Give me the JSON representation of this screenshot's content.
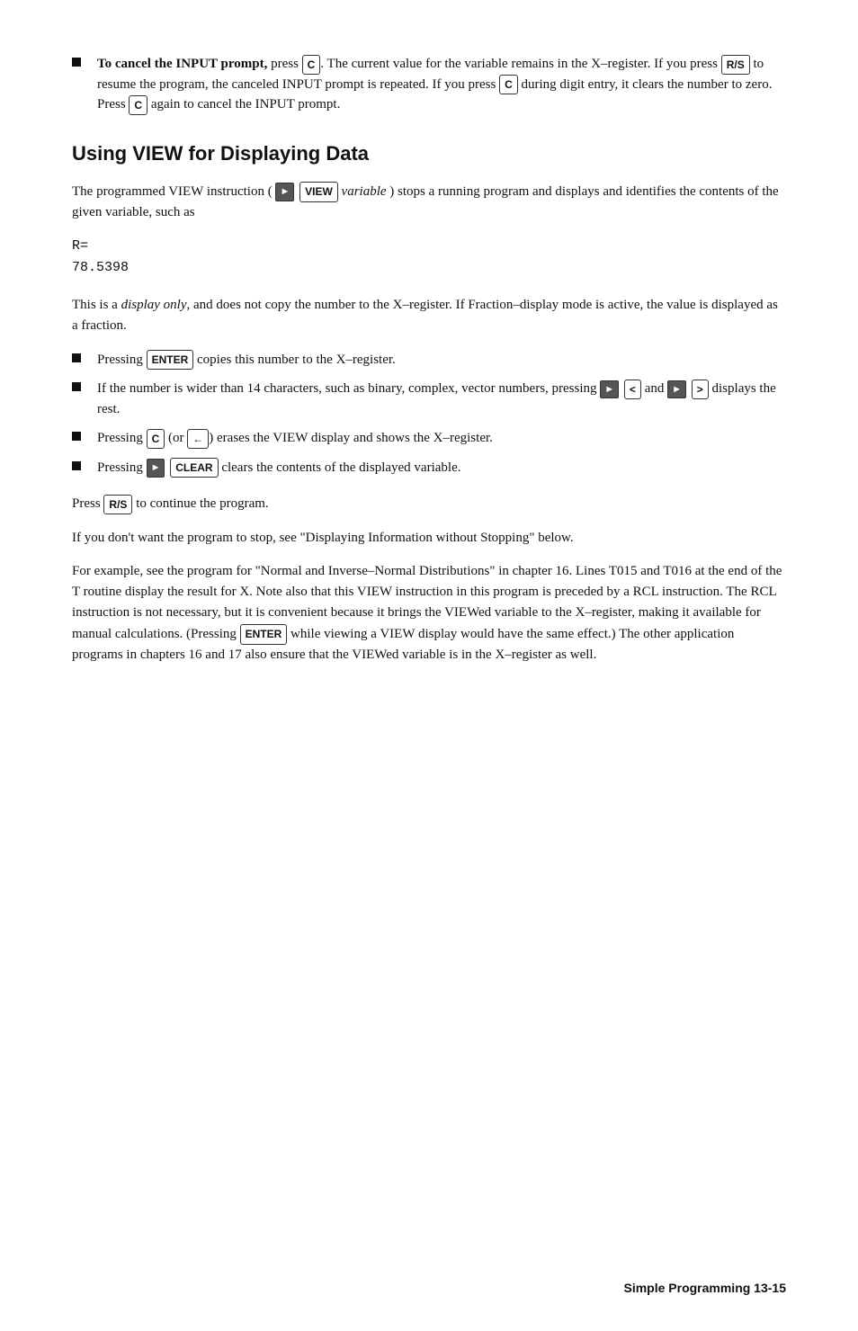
{
  "page": {
    "footer": "Simple Programming  13-15"
  },
  "bullet1": {
    "label_bold": "To cancel the INPUT prompt,",
    "text": " press ",
    "key1": "C",
    "after1": ". The current value for the variable remains in the X–register. If you press ",
    "key2": "R/S",
    "after2": " to resume the program, the canceled INPUT prompt is repeated. If you press ",
    "key3": "C",
    "after3": " during digit entry, it clears the number to zero. Press ",
    "key4": "C",
    "after4": " again to cancel the INPUT prompt."
  },
  "section_heading": "Using VIEW for Displaying Data",
  "para1_before": "The programmed VIEW instruction (",
  "para1_shift_icon": "shift",
  "para1_view_key": "VIEW",
  "para1_variable": " variable",
  "para1_after": " ) stops a running program and displays and identifies the contents of the given variable, such as",
  "code_line1": "R=",
  "code_line2": "78.5398",
  "para2": "This is a display only, and does not copy the number to the X–register. If Fraction–display mode is active, the value is displayed as a fraction.",
  "bullets": [
    {
      "before": "Pressing ",
      "key": "ENTER",
      "after": " copies this number to the X–register."
    },
    {
      "before": "If the number is wider than 14 characters, such as binary, complex, vector numbers, pressing ",
      "key1": "◄",
      "shift1": true,
      "mid": " and ",
      "key2": "►",
      "shift2": true,
      "after": " displays the rest."
    },
    {
      "before": "Pressing ",
      "key": "C",
      "mid": " (or ",
      "key2": "←",
      "after": ") erases the VIEW display and shows the X–register."
    },
    {
      "before": "Pressing ",
      "key1_shift": true,
      "key2": "CLEAR",
      "after": " clears the contents of the displayed variable."
    }
  ],
  "para3_before": "Press ",
  "para3_key": "R/S",
  "para3_after": " to continue the program.",
  "para4": "If you don't want the program to stop, see \"Displaying Information without Stopping\" below.",
  "para5": "For example, see the program for \"Normal and Inverse–Normal Distributions\" in chapter 16. Lines T015 and T016 at the end of the T routine display the result for X. Note also that this VIEW instruction in this program is preceded by a RCL instruction. The RCL instruction is not necessary, but it is convenient because it brings the VIEWed variable to the X–register, making it available for manual calculations. (Pressing ",
  "para5_key": "ENTER",
  "para5_after": " while viewing a VIEW display would have the same effect.) The other application programs in chapters 16 and 17 also ensure that the VIEWed variable is in the X–register as well."
}
